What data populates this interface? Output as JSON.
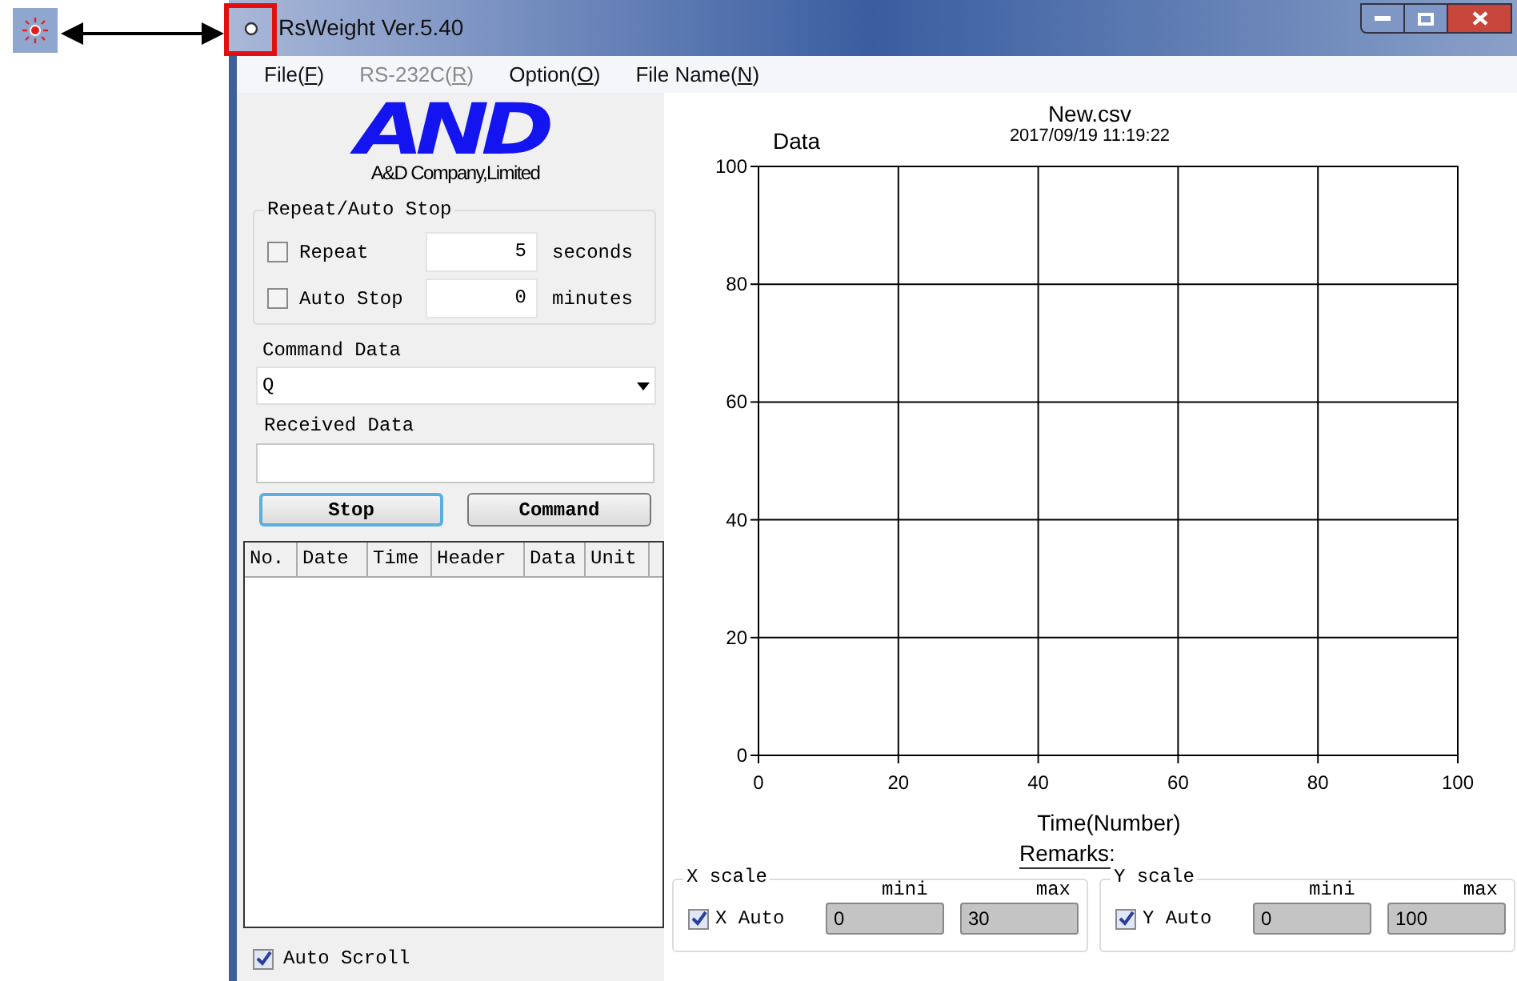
{
  "window": {
    "title": "RsWeight Ver.5.40"
  },
  "menu": [
    {
      "label": "File(F)",
      "disabled": false
    },
    {
      "label": "RS-232C(R)",
      "disabled": true
    },
    {
      "label": "Option(O)",
      "disabled": false
    },
    {
      "label": "File Name(N)",
      "disabled": false
    }
  ],
  "logo": {
    "mark": "AND",
    "company": "A&D Company,Limited"
  },
  "repeat_auto_stop": {
    "title": "Repeat/Auto Stop",
    "rows": [
      {
        "label": "Repeat",
        "checked": false,
        "value": "5",
        "unit": "seconds"
      },
      {
        "label": "Auto Stop",
        "checked": false,
        "value": "0",
        "unit": "minutes"
      }
    ]
  },
  "command_data": {
    "label": "Command Data",
    "value": "Q"
  },
  "received_data": {
    "label": "Received Data"
  },
  "buttons": [
    {
      "label": "Stop",
      "focused": true
    },
    {
      "label": "Command",
      "focused": false
    }
  ],
  "table": {
    "columns": [
      "No.",
      "Date",
      "Time",
      "Header",
      "Data",
      "Unit"
    ]
  },
  "auto_scroll": {
    "label": "Auto Scroll",
    "checked": true
  },
  "chart": {
    "subtitle": "2017/09/19 11:19:22",
    "remarks": "Remarks:",
    "chart_data": {
      "type": "line",
      "grid": true,
      "title": "New.csv",
      "xlabel": "Time(Number)",
      "ylabel": "Data",
      "xlim": [
        0,
        100
      ],
      "ylim": [
        0,
        100
      ],
      "xticks": [
        {
          "value": 0,
          "label": "0"
        },
        {
          "value": 20,
          "label": "20"
        },
        {
          "value": 40,
          "label": "40"
        },
        {
          "value": 60,
          "label": "60"
        },
        {
          "value": 80,
          "label": "80"
        },
        {
          "value": 100,
          "label": "100"
        }
      ],
      "yticks": [
        {
          "value": 0,
          "label": "0"
        },
        {
          "value": 20,
          "label": "20"
        },
        {
          "value": 40,
          "label": "40"
        },
        {
          "value": 60,
          "label": "60"
        },
        {
          "value": 80,
          "label": "80"
        },
        {
          "value": 100,
          "label": "100"
        }
      ]
    }
  },
  "scales": [
    {
      "title": "X scale",
      "auto_label": "X Auto",
      "auto": true,
      "min_label": "mini",
      "min": "0",
      "max_label": "max",
      "max": "30"
    },
    {
      "title": "Y scale",
      "auto_label": "Y Auto",
      "auto": true,
      "min_label": "mini",
      "min": "0",
      "max_label": "max",
      "max": "100"
    }
  ]
}
